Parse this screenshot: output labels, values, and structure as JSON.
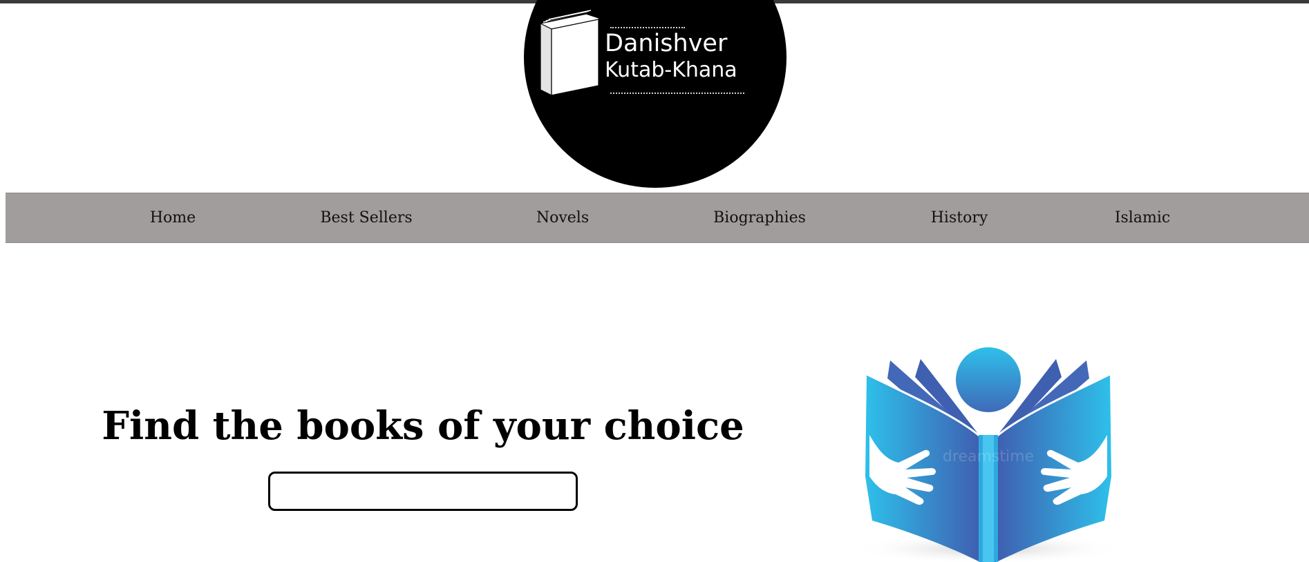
{
  "brand": {
    "name_line1": "Danishver",
    "name_line2": "Kutab-Khana",
    "logo_icon": "book-icon"
  },
  "nav": {
    "items": [
      {
        "label": "Home"
      },
      {
        "label": "Best Sellers"
      },
      {
        "label": "Novels"
      },
      {
        "label": "Biographies"
      },
      {
        "label": "History"
      },
      {
        "label": "Islamic"
      }
    ]
  },
  "hero": {
    "title": "Find the books of your choice",
    "search": {
      "value": "",
      "placeholder": ""
    },
    "illustration_icon": "person-reading-book-icon",
    "watermark": "dreamstime"
  },
  "colors": {
    "nav_background": "#a09d9c",
    "logo_background": "#000000",
    "illustration_light_blue": "#2ec0ea",
    "illustration_dark_blue": "#3f5fb0"
  }
}
